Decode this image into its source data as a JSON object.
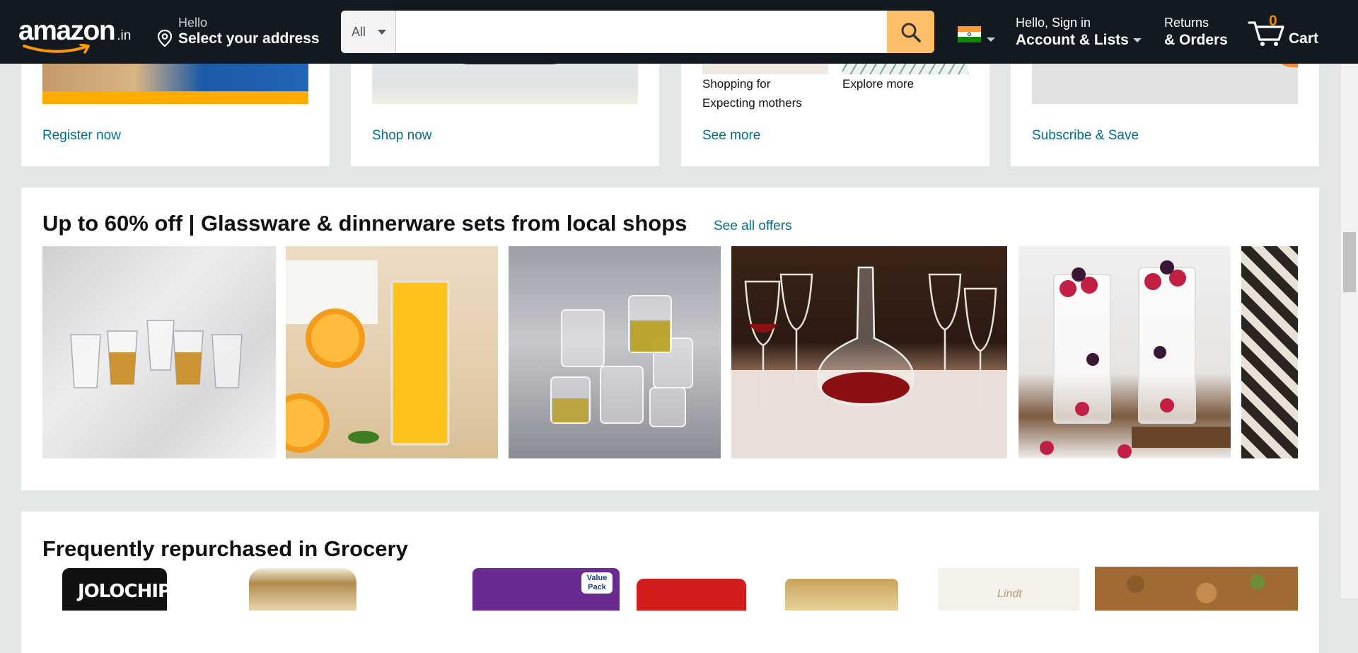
{
  "header": {
    "logo_text": "amazon",
    "logo_tld": ".in",
    "address_hello": "Hello",
    "address_cta": "Select your address",
    "search_category": "All",
    "search_placeholder": "",
    "account_line1": "Hello, Sign in",
    "account_line2": "Account & Lists",
    "orders_line1": "Returns",
    "orders_line2": "& Orders",
    "cart_count": "0",
    "cart_label": "Cart",
    "colors": {
      "bar": "#131921",
      "search_button": "#febd69",
      "cart_count": "#f08804"
    }
  },
  "top_cards": [
    {
      "link": "Register now"
    },
    {
      "link": "Shop now"
    },
    {
      "captions": [
        "Shopping for Expecting mothers",
        "Explore more"
      ],
      "link": "See more"
    },
    {
      "link": "Subscribe & Save"
    }
  ],
  "glassware": {
    "title": "Up to 60% off | Glassware & dinnerware sets from local shops",
    "see_all": "See all offers",
    "products": [
      {
        "icon": "shot-glasses-image"
      },
      {
        "icon": "orange-juice-glass-image"
      },
      {
        "icon": "glass-tumbler-set-image"
      },
      {
        "icon": "wine-glasses-decanter-image"
      },
      {
        "icon": "dessert-glasses-berries-image"
      },
      {
        "icon": "partial-product-image"
      }
    ]
  },
  "grocery": {
    "title": "Frequently repurchased in Grocery",
    "products": [
      {
        "icon": "chips-pack-image",
        "label": "JOLOCHIP"
      },
      {
        "icon": "ice-cream-tub-image"
      },
      {
        "icon": "snack-pack-image",
        "label": "Value Pack"
      },
      {
        "icon": "red-tin-image"
      },
      {
        "icon": "gold-box-image"
      },
      {
        "icon": "chocolate-box-image",
        "label": "Lindt"
      },
      {
        "icon": "mixed-nuts-image"
      }
    ]
  },
  "accent_link_color": "#007185"
}
